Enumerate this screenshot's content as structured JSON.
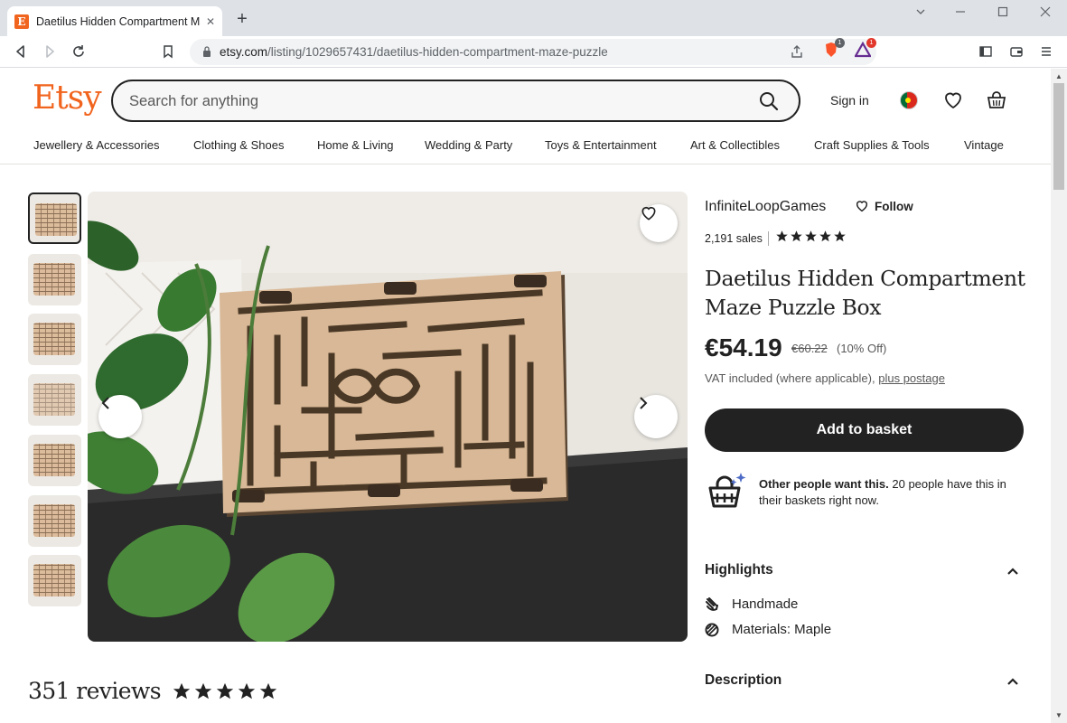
{
  "browser": {
    "tab_title": "Daetilus Hidden Compartment Maze Puzzle Box | Etsy",
    "favicon_letter": "E",
    "tab_close": "✕",
    "new_tab": "+",
    "url_host": "etsy.com",
    "url_path": "/listing/1029657431/daetilus-hidden-compartment-maze-puzzle",
    "ext_badge_brave": "1",
    "ext_badge_other": "1"
  },
  "header": {
    "logo": "Etsy",
    "search_placeholder": "Search for anything",
    "sign_in": "Sign in"
  },
  "categories": [
    "Jewellery & Accessories",
    "Clothing & Shoes",
    "Home & Living",
    "Wedding & Party",
    "Toys & Entertainment",
    "Art & Collectibles",
    "Craft Supplies & Tools",
    "Vintage"
  ],
  "listing": {
    "shop_name": "InfiniteLoopGames",
    "follow_label": "Follow",
    "sales": "2,191 sales",
    "rating_stars": 5,
    "title": "Daetilus Hidden Compartment Maze Puzzle Box",
    "price": "€54.19",
    "old_price": "€60.22",
    "discount": "(10% Off)",
    "vat_text": "VAT included (where applicable),",
    "postage_link": "plus postage",
    "add_to_basket": "Add to basket",
    "demand_bold": "Other people want this.",
    "demand_rest": "20 people have this in their baskets right now.",
    "thumbnail_count": 7,
    "selected_thumbnail": 1
  },
  "highlights": {
    "heading": "Highlights",
    "items": [
      {
        "icon": "hand-icon",
        "text": "Handmade"
      },
      {
        "icon": "material-icon",
        "text": "Materials: Maple"
      }
    ]
  },
  "description": {
    "heading": "Description"
  },
  "reviews": {
    "count_label": "351 reviews",
    "stars": 5
  },
  "colors": {
    "brand": "#f1641e",
    "button": "#222222"
  }
}
